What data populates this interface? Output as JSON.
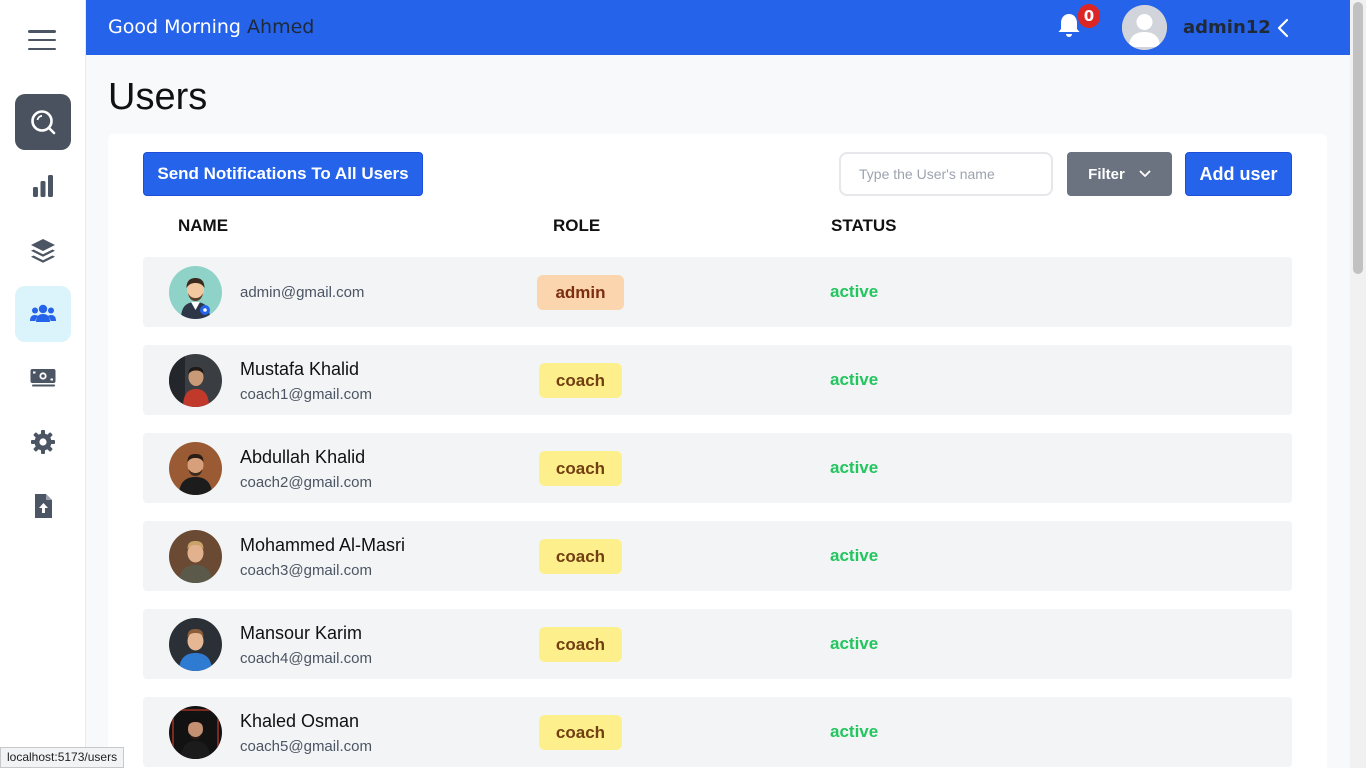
{
  "sidebar": {
    "items": [
      {
        "icon": "search-icon",
        "label": ""
      },
      {
        "icon": "bar-chart-icon",
        "label": ""
      },
      {
        "icon": "layers-icon",
        "label": ""
      },
      {
        "icon": "users-icon",
        "label": ""
      },
      {
        "icon": "money-icon",
        "label": ""
      },
      {
        "icon": "gear-icon",
        "label": ""
      },
      {
        "icon": "file-upload-icon",
        "label": ""
      }
    ]
  },
  "header": {
    "greeting": "Good Morning",
    "greeting_name": "Ahmed",
    "notification_count": "0",
    "username": "admin12"
  },
  "page": {
    "title": "Users"
  },
  "toolbar": {
    "notify_label": "Send Notifications To All Users",
    "search_placeholder": "Type the User's name",
    "search_value": "",
    "filter_label": "Filter",
    "add_label": "Add user"
  },
  "table": {
    "columns": [
      "NAME",
      "ROLE",
      "STATUS"
    ],
    "rows": [
      {
        "name": "",
        "email": "admin@gmail.com",
        "role": "admin",
        "status": "active"
      },
      {
        "name": "Mustafa Khalid",
        "email": "coach1@gmail.com",
        "role": "coach",
        "status": "active"
      },
      {
        "name": "Abdullah Khalid",
        "email": "coach2@gmail.com",
        "role": "coach",
        "status": "active"
      },
      {
        "name": "Mohammed Al-Masri",
        "email": "coach3@gmail.com",
        "role": "coach",
        "status": "active"
      },
      {
        "name": "Mansour Karim",
        "email": "coach4@gmail.com",
        "role": "coach",
        "status": "active"
      },
      {
        "name": "Khaled Osman",
        "email": "coach5@gmail.com",
        "role": "coach",
        "status": "active"
      }
    ]
  },
  "statusbar": {
    "url": "localhost:5173/users"
  },
  "colors": {
    "primary": "#2563eb",
    "active_status": "#22c55e",
    "admin_badge": "#fbd5ad",
    "coach_badge": "#fdf08c",
    "notification_badge": "#dc2626"
  }
}
